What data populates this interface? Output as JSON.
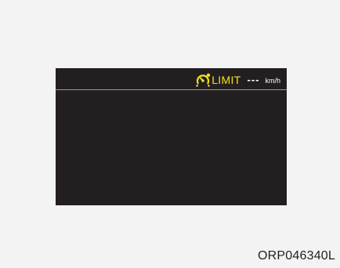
{
  "display": {
    "status_bar": {
      "icon": "speed-limiter-icon",
      "limit_label": "LIMIT",
      "limit_value": "---",
      "unit": "km/h"
    }
  },
  "figure_code": "ORP046340L",
  "colors": {
    "page_background": "#f3f3f3",
    "display_background": "#231f20",
    "limit_accent": "#f2e21d",
    "value_text": "#ffffff"
  }
}
